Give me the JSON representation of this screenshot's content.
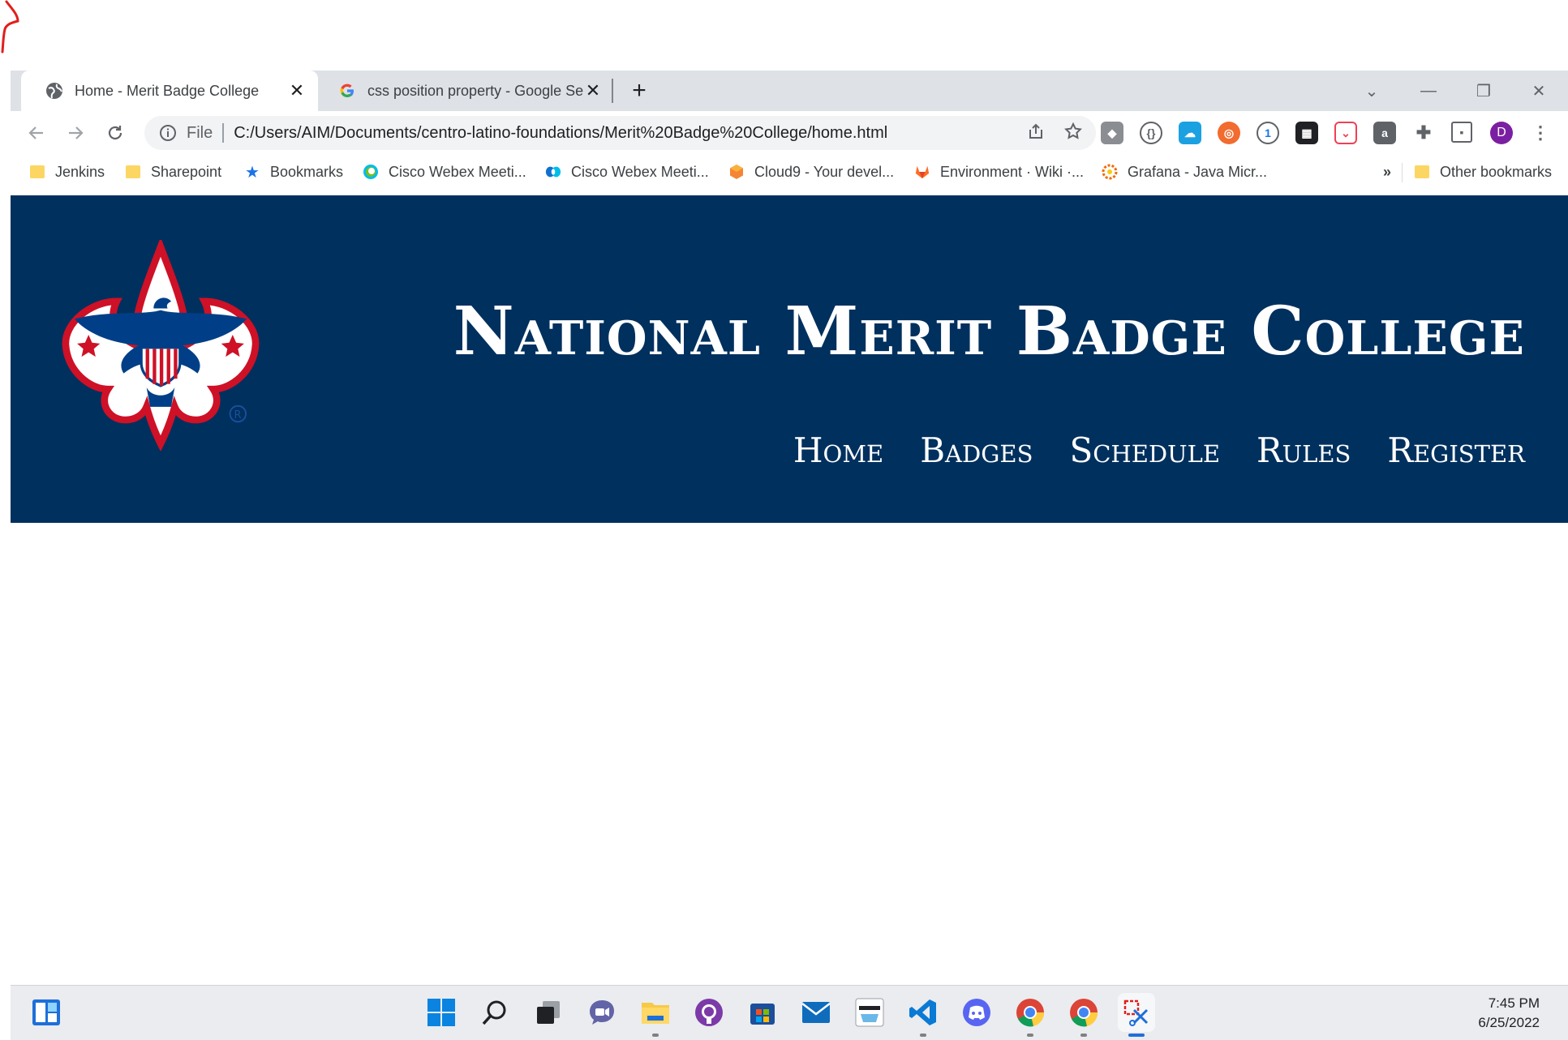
{
  "browser": {
    "tabs": [
      {
        "title": "Home - Merit Badge College",
        "active": true,
        "favicon": "globe-icon"
      },
      {
        "title": "css position property - Google Se",
        "active": false,
        "favicon": "google-icon"
      }
    ],
    "new_tab_label": "+",
    "address": {
      "scheme_label": "File",
      "url": "C:/Users/AIM/Documents/centro-latino-foundations/Merit%20Badge%20College/home.html"
    },
    "profile_initial": "D",
    "bookmarks": [
      {
        "label": "Jenkins",
        "icon": "folder-icon"
      },
      {
        "label": "Sharepoint",
        "icon": "folder-icon"
      },
      {
        "label": "Bookmarks",
        "icon": "star-icon"
      },
      {
        "label": "Cisco Webex Meeti...",
        "icon": "webex-icon"
      },
      {
        "label": "Cisco Webex Meeti...",
        "icon": "webex-icon"
      },
      {
        "label": "Cloud9 - Your devel...",
        "icon": "cloud9-icon"
      },
      {
        "label": "Environment · Wiki ·...",
        "icon": "gitlab-icon"
      },
      {
        "label": "Grafana - Java Micr...",
        "icon": "grafana-icon"
      }
    ],
    "overflow_label": "»",
    "other_bookmarks": "Other bookmarks"
  },
  "site": {
    "title": "National Merit Badge College",
    "nav": [
      "Home",
      "Badges",
      "Schedule",
      "Rules",
      "Register"
    ],
    "logo": "bsa-fleur-de-lis-logo",
    "colors": {
      "header_bg": "#00305e",
      "text": "#ffffff",
      "logo_red": "#ce1126"
    }
  },
  "taskbar": {
    "time": "7:45 PM",
    "date": "6/25/2022"
  }
}
